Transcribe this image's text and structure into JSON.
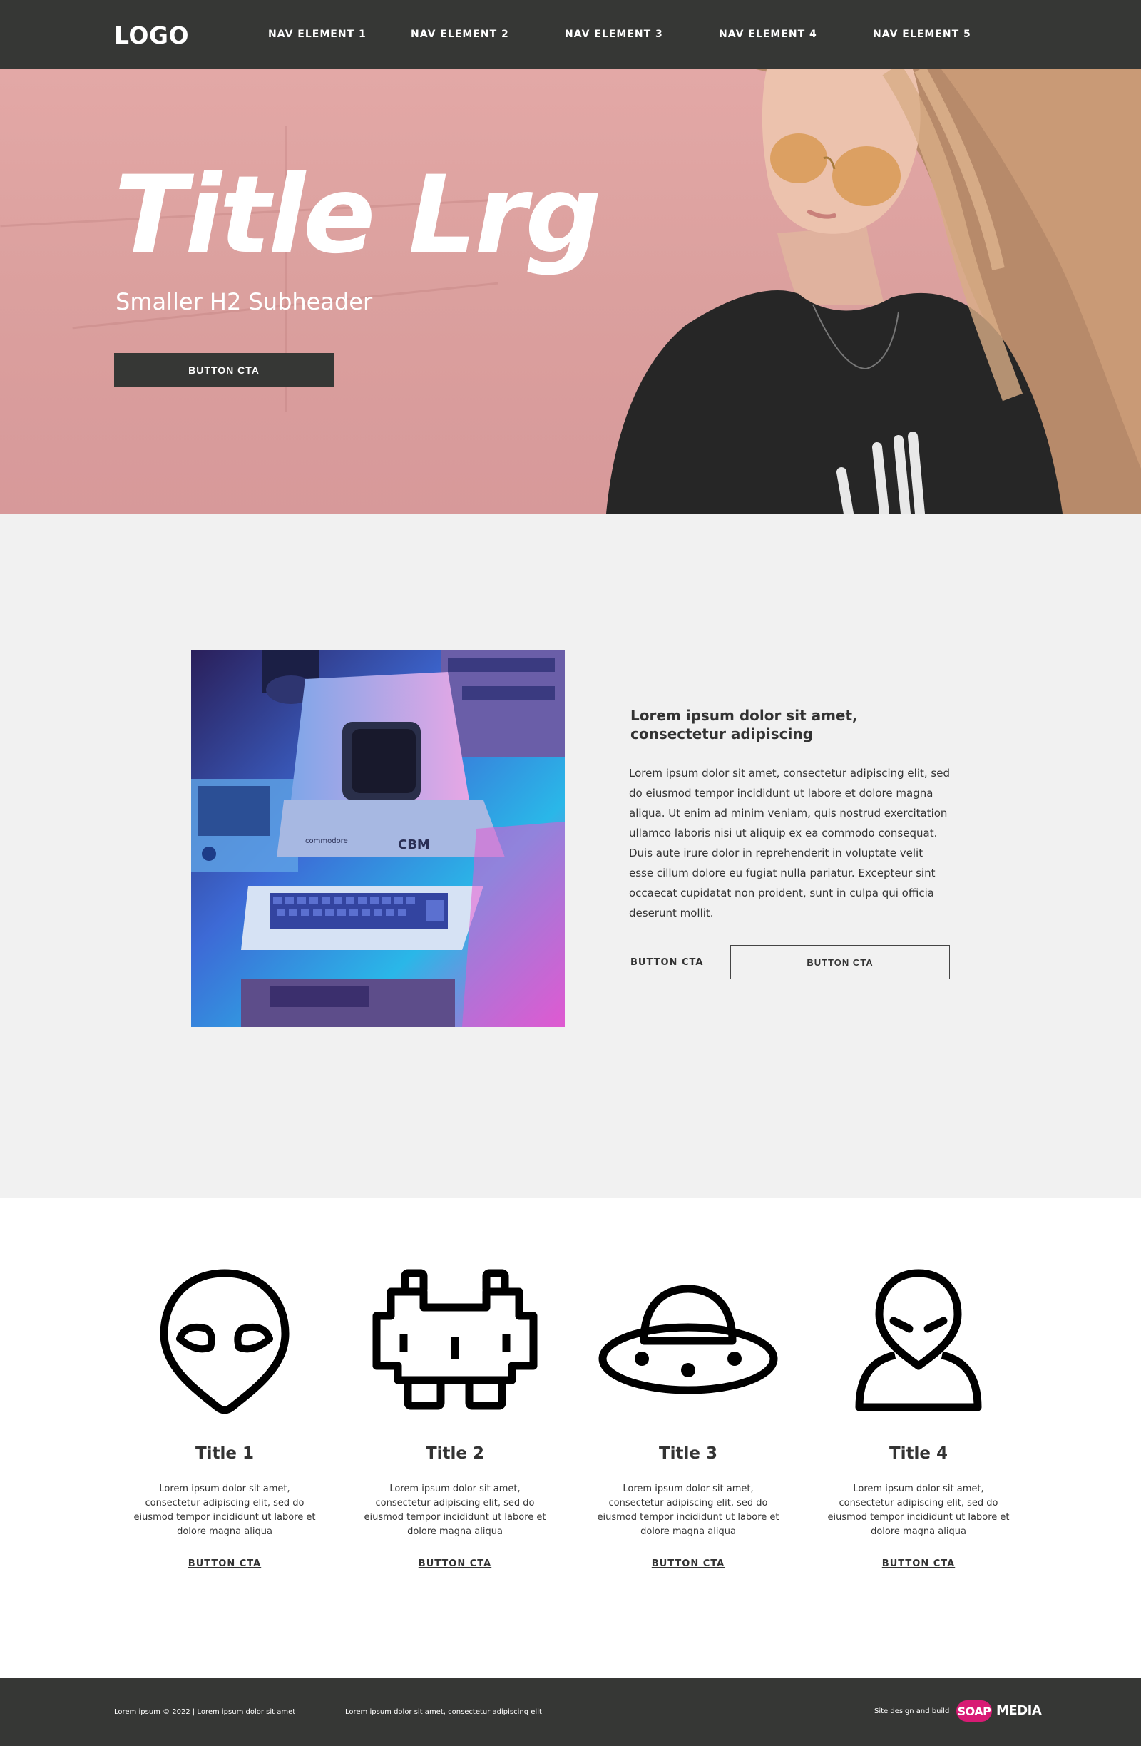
{
  "header": {
    "logo": "LOGO",
    "nav": [
      "NAV ELEMENT 1",
      "NAV ELEMENT 2",
      "NAV ELEMENT 3",
      "NAV ELEMENT 4",
      "NAV ELEMENT 5"
    ]
  },
  "hero": {
    "title": "Title Lrg",
    "subtitle": "Smaller H2 Subheader",
    "cta": "BUTTON CTA"
  },
  "feature": {
    "heading": "Lorem ipsum dolor sit amet, consectetur adipiscing",
    "body": "Lorem ipsum dolor sit amet, consectetur adipiscing elit, sed do eiusmod tempor incididunt ut labore et dolore magna aliqua. Ut enim ad minim veniam, quis nostrud exercitation ullamco laboris nisi ut aliquip ex ea commodo consequat. Duis aute irure dolor in reprehenderit in voluptate velit esse cillum dolore eu fugiat nulla pariatur. Excepteur sint occaecat cupidatat non proident, sunt in culpa qui officia deserunt mollit.",
    "link_cta": "BUTTON CTA",
    "button_cta": "BUTTON CTA",
    "image_text": {
      "brand": "commodore",
      "model": "CBM"
    }
  },
  "cards": [
    {
      "icon": "alien-head-icon",
      "title": "Title 1",
      "body": "Lorem ipsum dolor sit amet, consectetur adipiscing elit, sed do eiusmod tempor incididunt ut labore et dolore magna aliqua",
      "cta": "BUTTON CTA"
    },
    {
      "icon": "space-invader-icon",
      "title": "Title 2",
      "body": "Lorem ipsum dolor sit amet, consectetur adipiscing elit, sed do eiusmod tempor incididunt ut labore et dolore magna aliqua",
      "cta": "BUTTON CTA"
    },
    {
      "icon": "ufo-icon",
      "title": "Title 3",
      "body": "Lorem ipsum dolor sit amet, consectetur adipiscing elit, sed do eiusmod tempor incididunt ut labore et dolore magna aliqua",
      "cta": "BUTTON CTA"
    },
    {
      "icon": "alien-person-icon",
      "title": "Title 4",
      "body": "Lorem ipsum dolor sit amet, consectetur adipiscing elit, sed do eiusmod tempor incididunt ut labore et dolore magna aliqua",
      "cta": "BUTTON CTA"
    }
  ],
  "footer": {
    "copyright": "Lorem ipsum © 2022 | Lorem ipsum dolor sit amet",
    "tagline": "Lorem ipsum dolor sit amet, consectetur adipiscing elit",
    "credit": "Site design and build",
    "brand_badge": "SOAP",
    "brand_text": "MEDIA"
  },
  "colors": {
    "dark": "#363735",
    "hero_pink": "#dba09e",
    "section_grey": "#f1f1f1",
    "brand_magenta": "#d81b74"
  }
}
